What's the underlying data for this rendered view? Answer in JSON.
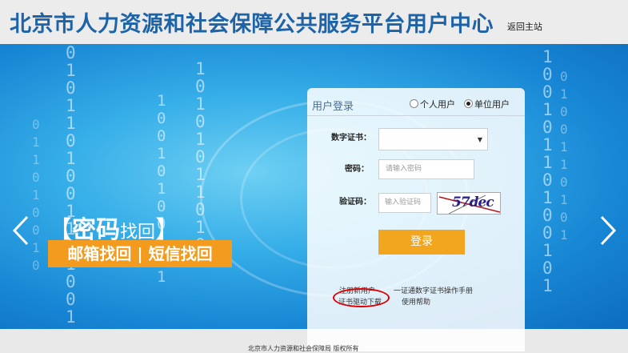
{
  "header": {
    "title": "北京市人力资源和社会保障公共服务平台用户中心",
    "back_home": "返回主站"
  },
  "promo": {
    "title_big": "密码",
    "title_small": "找回",
    "bracket_left": "【",
    "bracket_right": "】",
    "subtitle": "邮箱找回 | 短信找回"
  },
  "login": {
    "title": "用户登录",
    "user_types": [
      {
        "label": "个人用户",
        "selected": false
      },
      {
        "label": "单位用户",
        "selected": true
      }
    ],
    "cert_label": "数字证书：",
    "cert_value": "",
    "password_label": "密码：",
    "password_placeholder": "请输入密码",
    "captcha_label": "验证码：",
    "captcha_placeholder": "输入验证码",
    "captcha_text": "57dec",
    "submit": "登录",
    "links": {
      "register": "注册新用户",
      "manual": "一证通数字证书操作手册",
      "driver_download": "证书驱动下载",
      "help": "使用帮助"
    }
  },
  "footer": {
    "text": "北京市人力资源和社会保障局 版权所有"
  },
  "colors": {
    "title_blue": "#1d63a8",
    "accent_orange": "#f2a51f",
    "highlight_red": "#d00000"
  }
}
